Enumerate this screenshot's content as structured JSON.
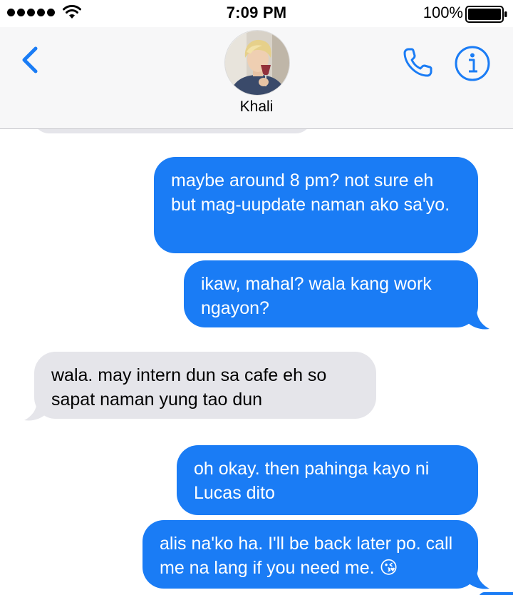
{
  "status_bar": {
    "time": "7:09 PM",
    "battery_percent": "100%",
    "signal_bars": 5,
    "icons": [
      "signal-dots",
      "wifi-icon",
      "battery-icon"
    ]
  },
  "header": {
    "contact_name": "Khali",
    "back_icon": "chevron-left-icon",
    "actions": [
      "phone-icon",
      "info-icon"
    ],
    "accent_color": "#1a7cf5"
  },
  "messages": [
    {
      "direction": "received",
      "text": ""
    },
    {
      "direction": "sent",
      "text": "maybe around 8 pm? not sure eh but mag-uupdate naman ako sa'yo."
    },
    {
      "direction": "sent",
      "text": "ikaw, mahal? wala kang work ngayon?"
    },
    {
      "direction": "received",
      "text": "wala. may intern dun sa cafe eh so sapat naman yung tao dun"
    },
    {
      "direction": "sent",
      "text": "oh okay. then pahinga kayo ni Lucas dito"
    },
    {
      "direction": "sent",
      "text": "alis na'ko ha. I'll be back later po. call me na lang if you need me. 😘"
    }
  ],
  "colors": {
    "sent_bubble": "#1a7cf5",
    "received_bubble": "#e5e5ea",
    "header_bg": "#f7f7f8"
  }
}
